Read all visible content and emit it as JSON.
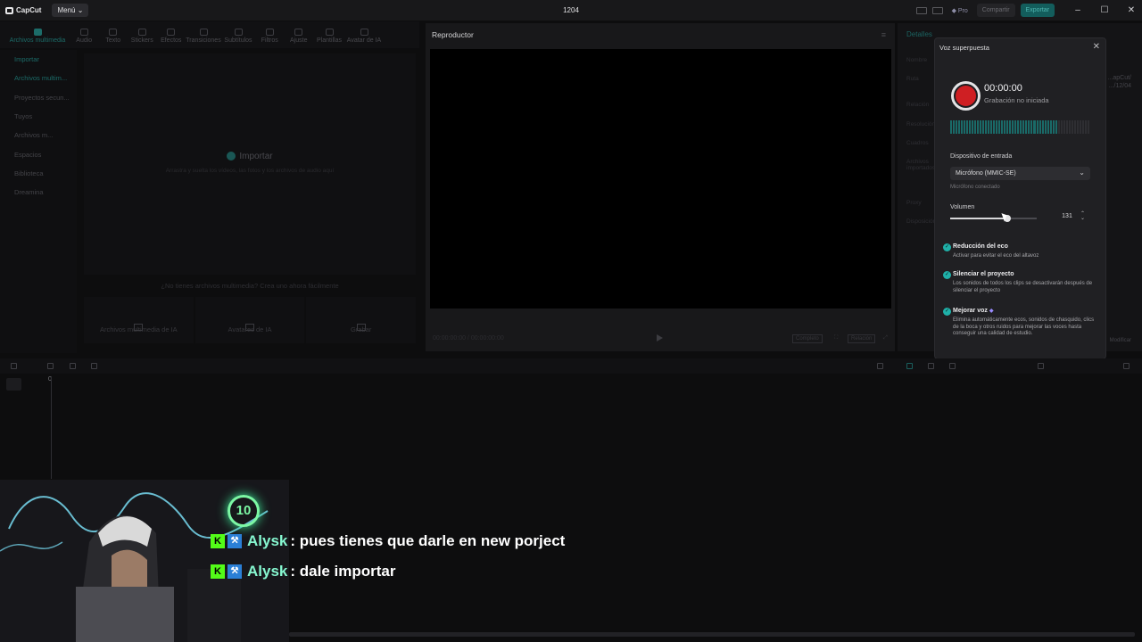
{
  "app": {
    "name": "CapCut",
    "menu_label": "Menú",
    "window_title": "1204"
  },
  "titlebar": {
    "pro_label": "Pro",
    "share_label": "Compartir",
    "export_label": "Exportar"
  },
  "toolbar": {
    "tools": [
      "Archivos multimedia",
      "Audio",
      "Texto",
      "Stickers",
      "Efectos",
      "Transiciones",
      "Subtítulos",
      "Filtros",
      "Ajuste",
      "Plantillas",
      "Avatar de IA"
    ]
  },
  "sidebar": {
    "items": [
      "Importar",
      "Archivos multim...",
      "Proyectos secun...",
      "Tuyos",
      "Archivos m...",
      "Espacios",
      "Biblioteca",
      "Dreamina"
    ]
  },
  "media": {
    "import_label": "Importar",
    "import_hint": "Arrastra y suelta los vídeos, las fotos y los archivos de audio aquí",
    "no_media": "¿No tienes archivos multimedia? Crea uno ahora fácilmente",
    "cards": [
      "Archivos multimedia de IA",
      "Avatares de IA",
      "Grabar"
    ]
  },
  "player": {
    "title": "Reproductor",
    "time_placeholder": "00:00:00:00 / 00:00:00:00",
    "btn_full": "Completo",
    "btn_ratio": "Relación"
  },
  "details": {
    "title": "Detalles",
    "items": [
      "Nombre",
      "Ruta",
      "Relación",
      "Resolución",
      "Cuadros",
      "Archivos importados",
      "Proxy",
      "Disposición"
    ],
    "path_value": "...apCut/",
    "date_value": ".../12/04",
    "modify_label": "Modificar"
  },
  "voiceover": {
    "title": "Voz superpuesta",
    "timer": "00:00:00",
    "status": "Grabación no iniciada",
    "level_fraction": 0.77,
    "input_label": "Dispositivo de entrada",
    "input_value": "Micrófono (MMIC-SE)",
    "mic_status": "Micrófono conectado",
    "volume_label": "Volumen",
    "volume_value": "131",
    "volume_fraction": 0.66,
    "options": [
      {
        "title": "Reducción del eco",
        "desc": "Activar para evitar el eco del altavoz",
        "checked": true
      },
      {
        "title": "Silenciar el proyecto",
        "desc": "Los sonidos de todos los clips se desactivarán después de silenciar el proyecto",
        "checked": true
      },
      {
        "title": "Mejorar voz",
        "desc": "Elimina automáticamente ecos, sonidos de chasquido, clics de la boca y otros ruidos para mejorar las voces hasta conseguir una calidad de estudio.",
        "checked": true,
        "premium_icon": "gem-icon"
      }
    ]
  },
  "timeline": {
    "playhead_label": "0"
  },
  "overlay": {
    "cam_badge": "10",
    "chat": [
      {
        "user": "Alysk",
        "message": ": pues tienes que darle en new porject"
      },
      {
        "user": "Alysk",
        "message": ": dale importar"
      }
    ]
  },
  "colors": {
    "accent": "#1fb0a8",
    "record": "#cf1f23",
    "export_bg": "#135d5c",
    "chat_user": "#86f7d0",
    "kick_green": "#53fc18"
  }
}
